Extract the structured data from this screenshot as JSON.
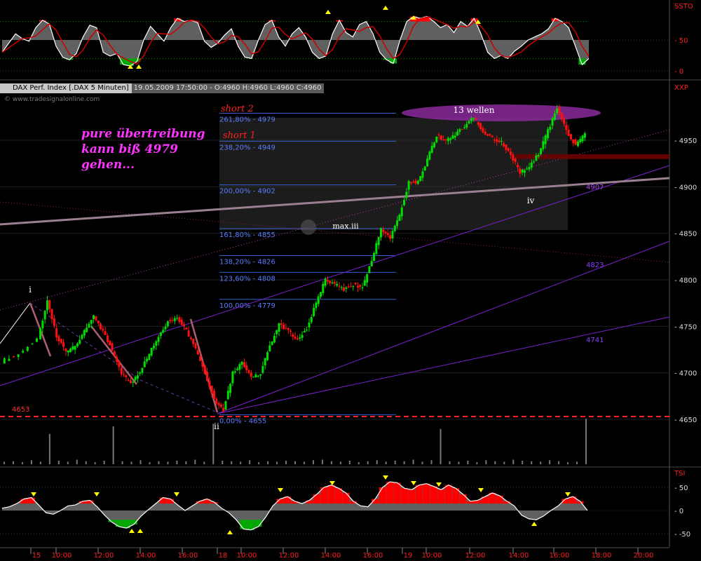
{
  "header": {
    "symbol": "DAX Perf. Index [.DAX  5 Minuten]",
    "quote": "19.05.2009 17:50:00 - O:4960 H:4960 L:4960 C:4960",
    "watermark": "© www.tradesignalonline.com"
  },
  "panels": {
    "top_tag": "SSTO",
    "main_tag": "XXP",
    "bottom_tag": "TSI"
  },
  "annotation_note": [
    "pure übertreibung",
    "kann biß 4979",
    "gehen..."
  ],
  "chart_data": [
    {
      "type": "line",
      "name": "SSTO",
      "yticks": [
        0,
        50
      ],
      "ylim": [
        -5,
        105
      ],
      "series": [
        {
          "name": "fast",
          "color": "#ffffff"
        },
        {
          "name": "slow",
          "color": "#cc0000"
        }
      ],
      "values_fast": [
        30,
        45,
        60,
        52,
        48,
        70,
        82,
        76,
        40,
        22,
        18,
        28,
        55,
        74,
        70,
        30,
        24,
        28,
        10,
        8,
        15,
        50,
        72,
        60,
        48,
        70,
        85,
        80,
        82,
        78,
        48,
        38,
        45,
        58,
        68,
        40,
        22,
        20,
        50,
        75,
        82,
        55,
        40,
        60,
        70,
        55,
        30,
        20,
        24,
        60,
        82,
        62,
        55,
        75,
        80,
        60,
        30,
        18,
        12,
        50,
        80,
        88,
        85,
        88,
        80,
        70,
        75,
        62,
        80,
        72,
        85,
        60,
        30,
        20,
        25,
        20,
        32,
        40,
        50,
        55,
        60,
        68,
        85,
        80,
        70,
        40,
        10,
        20
      ],
      "threshold_upper": 80,
      "threshold_lower": 20
    },
    {
      "type": "line",
      "name": "DAX Perf. Index 5 Minuten",
      "yticks": [
        4650,
        4700,
        4750,
        4800,
        4850,
        4900,
        4950
      ],
      "ylim": [
        4615,
        4975
      ],
      "xticks": [
        "15",
        "10:00",
        "12:00",
        "14:00",
        "16:00",
        "18",
        "10:00",
        "12:00",
        "14:00",
        "16:00",
        "19",
        "10:00",
        "12:00",
        "14:00",
        "16:00",
        "18:00",
        "20:00"
      ],
      "fibonacci": [
        {
          "label": "261,80% - 4979",
          "value": 4979
        },
        {
          "label": "238,20% - 4949",
          "value": 4949
        },
        {
          "label": "200,00% - 4902",
          "value": 4902
        },
        {
          "label": "161,80% - 4855",
          "value": 4855
        },
        {
          "label": "138,20% - 4826",
          "value": 4826
        },
        {
          "label": "123,60% - 4808",
          "value": 4808
        },
        {
          "label": "100,00% - 4779",
          "value": 4779
        },
        {
          "label": "0,00% - 4655",
          "value": 4655
        }
      ],
      "channel_labels": [
        {
          "label": "4907",
          "value": 4907
        },
        {
          "label": "4823",
          "value": 4823
        },
        {
          "label": "4741",
          "value": 4741
        }
      ],
      "support_line": {
        "label": "4653",
        "value": 4653,
        "color": "#ff2020"
      },
      "wave_labels": [
        "i",
        "ii",
        "max.iii",
        "iv",
        "13 wellen"
      ],
      "short_labels": [
        "short 2",
        "short 1"
      ],
      "close_path": [
        [
          0,
          4712
        ],
        [
          4,
          4720
        ],
        [
          8,
          4738
        ],
        [
          10,
          4778
        ],
        [
          12,
          4740
        ],
        [
          14,
          4722
        ],
        [
          16,
          4728
        ],
        [
          18,
          4745
        ],
        [
          20,
          4760
        ],
        [
          22,
          4745
        ],
        [
          24,
          4725
        ],
        [
          26,
          4700
        ],
        [
          28,
          4688
        ],
        [
          30,
          4702
        ],
        [
          32,
          4720
        ],
        [
          34,
          4740
        ],
        [
          36,
          4755
        ],
        [
          38,
          4760
        ],
        [
          40,
          4745
        ],
        [
          42,
          4725
        ],
        [
          44,
          4700
        ],
        [
          46,
          4672
        ],
        [
          48,
          4660
        ],
        [
          50,
          4700
        ],
        [
          52,
          4710
        ],
        [
          54,
          4695
        ],
        [
          56,
          4700
        ],
        [
          58,
          4728
        ],
        [
          60,
          4752
        ],
        [
          62,
          4745
        ],
        [
          64,
          4735
        ],
        [
          66,
          4748
        ],
        [
          68,
          4775
        ],
        [
          70,
          4800
        ],
        [
          72,
          4795
        ],
        [
          74,
          4790
        ],
        [
          76,
          4795
        ],
        [
          78,
          4792
        ],
        [
          80,
          4820
        ],
        [
          82,
          4855
        ],
        [
          84,
          4845
        ],
        [
          86,
          4870
        ],
        [
          88,
          4905
        ],
        [
          90,
          4905
        ],
        [
          92,
          4930
        ],
        [
          94,
          4955
        ],
        [
          96,
          4950
        ],
        [
          98,
          4955
        ],
        [
          100,
          4965
        ],
        [
          102,
          4975
        ],
        [
          104,
          4960
        ],
        [
          106,
          4952
        ],
        [
          108,
          4948
        ],
        [
          110,
          4935
        ],
        [
          112,
          4915
        ],
        [
          114,
          4922
        ],
        [
          116,
          4935
        ],
        [
          118,
          4960
        ],
        [
          120,
          4985
        ],
        [
          122,
          4960
        ],
        [
          124,
          4945
        ],
        [
          126,
          4956
        ]
      ],
      "volume": [
        5,
        6,
        4,
        8,
        5,
        60,
        7,
        5,
        9,
        6,
        4,
        7,
        75,
        6,
        5,
        8,
        4,
        6,
        5,
        7,
        6,
        9,
        5,
        80,
        7,
        6,
        5,
        8,
        4,
        6,
        5,
        7,
        6,
        5,
        8,
        9,
        6,
        5,
        7,
        4,
        6,
        8,
        5,
        7,
        6,
        9,
        5,
        8,
        70,
        6,
        5,
        7,
        4,
        8,
        6,
        5,
        9,
        7,
        6,
        5,
        8,
        6,
        4,
        5,
        90
      ]
    },
    {
      "type": "area",
      "name": "TSI",
      "yticks": [
        -50,
        0,
        50
      ],
      "ylim": [
        -75,
        75
      ],
      "values": [
        5,
        8,
        15,
        25,
        28,
        12,
        -5,
        -8,
        0,
        10,
        12,
        20,
        22,
        8,
        -10,
        -25,
        -35,
        -38,
        -30,
        -12,
        2,
        15,
        28,
        25,
        12,
        0,
        10,
        20,
        25,
        18,
        5,
        -5,
        -20,
        -40,
        -42,
        -35,
        -15,
        10,
        25,
        30,
        20,
        15,
        22,
        35,
        50,
        55,
        48,
        38,
        20,
        10,
        8,
        25,
        50,
        62,
        60,
        48,
        45,
        55,
        58,
        52,
        45,
        55,
        48,
        35,
        20,
        22,
        30,
        38,
        32,
        20,
        10,
        -10,
        -18,
        -20,
        -12,
        0,
        10,
        25,
        30,
        20,
        0
      ]
    }
  ]
}
